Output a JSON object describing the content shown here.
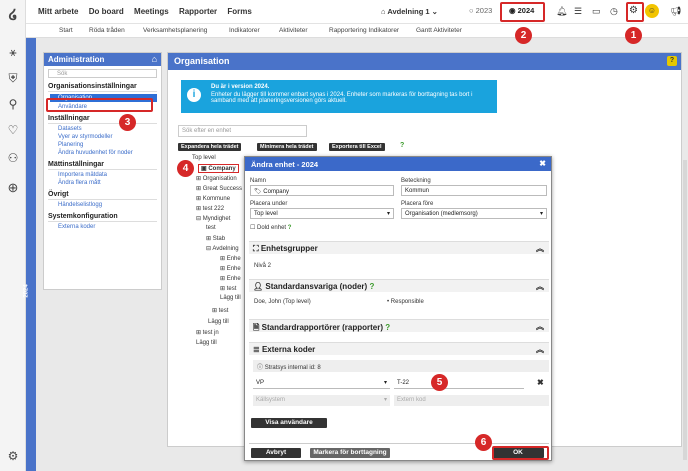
{
  "topnav": {
    "items": [
      "Mitt arbete",
      "Do board",
      "Meetings",
      "Rapporter",
      "Forms"
    ],
    "unit_selector": "Avdelning 1",
    "year_prev": "2023",
    "year_current": "2024"
  },
  "subnav": [
    "Start",
    "Röda tråden",
    "Verksamhetsplanering",
    "Indikatorer",
    "Aktiviteter",
    "Rapportering Indikatorer",
    "Gantt Aktiviteter"
  ],
  "year_strip": "2024",
  "admin": {
    "title": "Administration",
    "search_placeholder": "Sök",
    "groups": [
      {
        "title": "Organisationsinställningar",
        "items": [
          "Organisation",
          "Användare"
        ]
      },
      {
        "title": "Inställningar",
        "items": [
          "Datasets",
          "Vyer av styrmodeller",
          "Planering",
          "Ändra huvudenhet för noder"
        ]
      },
      {
        "title": "Mättinställningar",
        "items": [
          "Importera mätdata",
          "Ändra flera mått"
        ]
      },
      {
        "title": "Övrigt",
        "items": [
          "Händelselistlogg"
        ]
      },
      {
        "title": "Systemkonfiguration",
        "items": [
          "Externa koder"
        ]
      }
    ]
  },
  "org": {
    "title": "Organisation",
    "info_title": "Du är i version 2024.",
    "info_text": "Enheter du lägger till kommer enbart synas i 2024. Enheter som markeras för borttagning tas bort i samband med att planeringsversionen görs aktuell.",
    "search_placeholder": "Sök efter en enhet",
    "btn_expand": "Expandera hela trädet",
    "btn_minimize": "Minimera hela trädet",
    "btn_export": "Exportera till Excel",
    "tree": [
      "Top level",
      "Company",
      "Organisation",
      "Great Success",
      "Kommune",
      "test 222",
      "Myndighet",
      "test",
      "Stab",
      "Avdelning",
      "Enhe",
      "Enhe",
      "Enhe",
      "test",
      "Lägg till",
      "test",
      "Lägg till",
      "test jn",
      "Lägg till"
    ]
  },
  "modal": {
    "title": "Ändra enhet - 2024",
    "name_label": "Namn",
    "name_value": "Company",
    "designation_label": "Beteckning",
    "designation_value": "Kommun",
    "place_under_label": "Placera under",
    "place_under_value": "Top level",
    "place_before_label": "Placera före",
    "place_before_value": "Organisation (medlemsorg)",
    "hidden_label": "Dold enhet",
    "sec_groups": "Enhetsgrupper",
    "level": "Nivå 2",
    "sec_resp": "Standardansvariga (noder)",
    "resp_name": "Doe, John (Top level)",
    "resp_role": "Responsible",
    "sec_reporters": "Standardrapportörer (rapporter)",
    "sec_codes": "Externa koder",
    "internal_id": "Stratsys internal id: 8",
    "code_system": "VP",
    "code_value": "T-22",
    "source_placeholder": "Källsystem",
    "code_placeholder": "Extern kod",
    "btn_show_users": "Visa användare",
    "btn_cancel": "Avbryt",
    "btn_mark_delete": "Markera för borttagning",
    "btn_ok": "OK"
  },
  "badges": [
    "1",
    "2",
    "3",
    "4",
    "5",
    "6"
  ],
  "colors": {
    "accent": "#4a73c9",
    "marker": "#d62828",
    "info": "#1aa3dd"
  }
}
